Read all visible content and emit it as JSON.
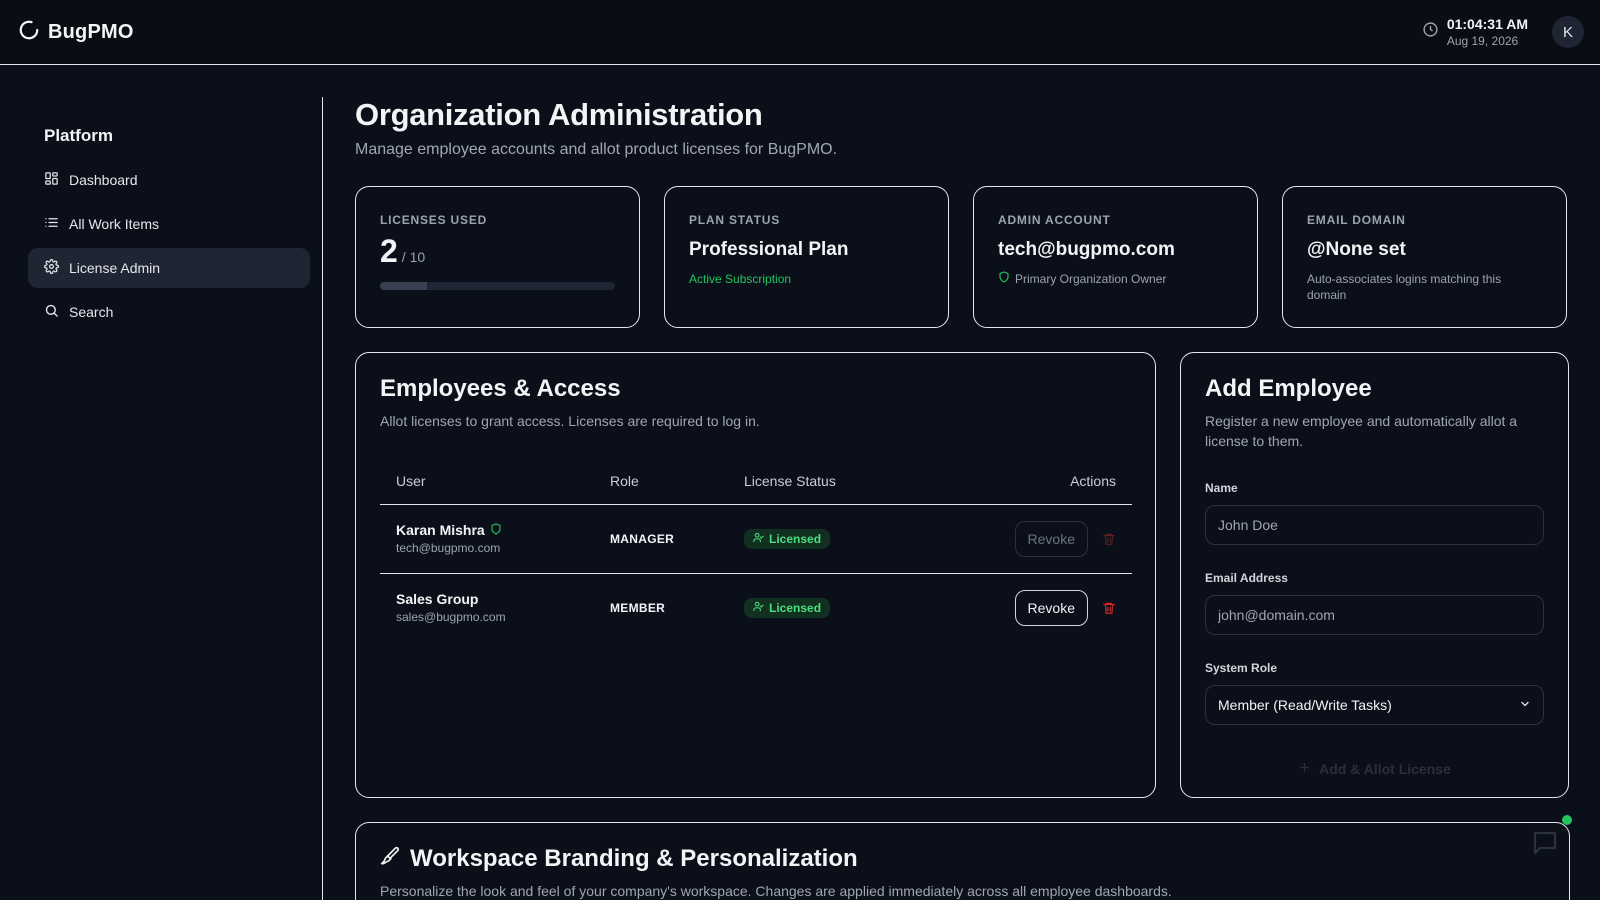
{
  "app": {
    "name": "BugPMO"
  },
  "header": {
    "time": "01:04:31 AM",
    "date": "Aug 19, 2026",
    "avatar_initial": "K"
  },
  "sidebar": {
    "title": "Platform",
    "items": [
      {
        "label": "Dashboard",
        "icon": "dashboard-grid-icon"
      },
      {
        "label": "All Work Items",
        "icon": "list-icon"
      },
      {
        "label": "License Admin",
        "icon": "gear-icon",
        "active": true
      },
      {
        "label": "Search",
        "icon": "search-icon"
      }
    ]
  },
  "page": {
    "title": "Organization Administration",
    "subtitle": "Manage employee accounts and allot product licenses for BugPMO."
  },
  "stats": {
    "licenses": {
      "label": "LICENSES USED",
      "used": "2",
      "total": "/ 10",
      "fill_fraction": 0.2
    },
    "plan": {
      "label": "PLAN STATUS",
      "value": "Professional Plan",
      "note": "Active Subscription"
    },
    "admin": {
      "label": "ADMIN ACCOUNT",
      "value": "tech@bugpmo.com",
      "note": "Primary Organization Owner"
    },
    "domain": {
      "label": "EMAIL DOMAIN",
      "value": "@None set",
      "note": "Auto-associates logins matching this domain"
    }
  },
  "employees": {
    "title": "Employees & Access",
    "subtitle": "Allot licenses to grant access. Licenses are required to log in.",
    "columns": {
      "user": "User",
      "role": "Role",
      "status": "License Status",
      "actions": "Actions"
    },
    "rows": [
      {
        "name": "Karan Mishra",
        "email": "tech@bugpmo.com",
        "role": "MANAGER",
        "status": "Licensed",
        "action": "Revoke",
        "owner": true
      },
      {
        "name": "Sales Group",
        "email": "sales@bugpmo.com",
        "role": "MEMBER",
        "status": "Licensed",
        "action": "Revoke",
        "owner": false
      }
    ]
  },
  "add_employee": {
    "title": "Add Employee",
    "subtitle": "Register a new employee and automatically allot a license to them.",
    "name_label": "Name",
    "name_placeholder": "John Doe",
    "email_label": "Email Address",
    "email_placeholder": "john@domain.com",
    "role_label": "System Role",
    "role_value": "Member (Read/Write Tasks)",
    "submit_label": "Add & Allot License"
  },
  "branding": {
    "title": "Workspace Branding & Personalization",
    "subtitle": "Personalize the look and feel of your company's workspace. Changes are applied immediately across all employee dashboards."
  },
  "colors": {
    "accent_green": "#22c55e",
    "danger": "#dc2626",
    "background": "#0b0f1a"
  }
}
